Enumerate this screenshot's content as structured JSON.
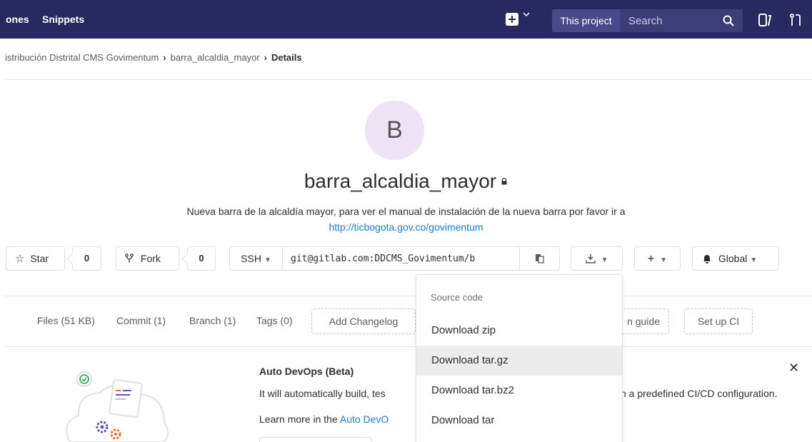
{
  "nav": {
    "links": [
      "ones",
      "Snippets"
    ],
    "scope": "This project",
    "search_placeholder": "Search",
    "icons": [
      "plus-square-icon",
      "chevron-down-icon",
      "search-icon",
      "todos-icon",
      "merge-request-icon"
    ]
  },
  "breadcrumb": {
    "group": "istribución Distrital CMS Govimentum",
    "project": "barra_alcaldia_mayor",
    "current": "Details"
  },
  "project": {
    "avatar_letter": "B",
    "name": "barra_alcaldia_mayor",
    "description": "Nueva barra de la alcaldía mayor, para ver el manual de instalación de la nueva barra por favor ir a",
    "link": "http://ticbogota.gov.co/govimentum"
  },
  "actions": {
    "star_label": "Star",
    "star_count": "0",
    "fork_label": "Fork",
    "fork_count": "0",
    "protocol": "SSH",
    "clone_url": "git@gitlab.com:DDCMS_Govimentum/b",
    "notification": "Global"
  },
  "stats": {
    "files": "Files (51 KB)",
    "commit": "Commit (1)",
    "branch": "Branch (1)",
    "tags": "Tags (0)",
    "add_changelog": "Add Changelog",
    "contribution_guide_partial": "n guide",
    "setup_ci": "Set up CI"
  },
  "devops": {
    "title": "Auto DevOps (Beta)",
    "text_left": "It will automatically build, tes",
    "text_right": "n a predefined CI/CD configuration.",
    "learn_prefix": "Learn more in the ",
    "learn_link": "Auto DevO"
  },
  "download_menu": {
    "header": "Source code",
    "items": [
      "Download zip",
      "Download tar.gz",
      "Download tar.bz2",
      "Download tar"
    ],
    "active_index": 1
  },
  "colors": {
    "topbar": "#292961",
    "link": "#1f78d1",
    "avatar_bg": "#eee3f5"
  }
}
